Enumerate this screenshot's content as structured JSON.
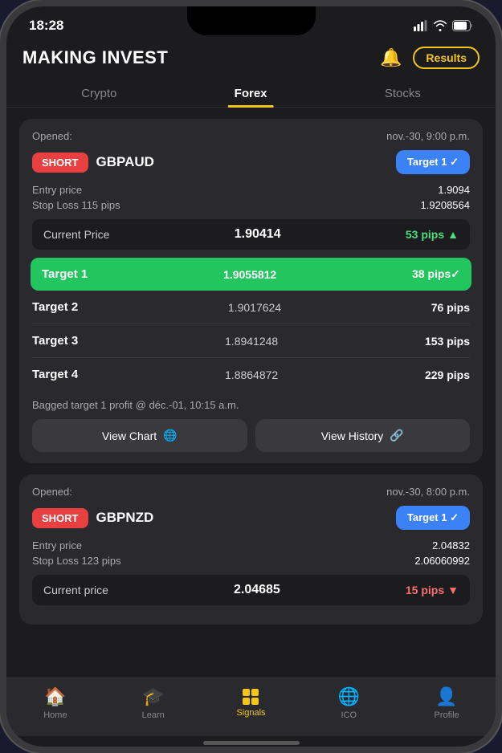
{
  "status_bar": {
    "time": "18:28"
  },
  "header": {
    "title": "MAKING INVEST",
    "results_label": "Results"
  },
  "tabs": [
    {
      "id": "crypto",
      "label": "Crypto",
      "active": false
    },
    {
      "id": "forex",
      "label": "Forex",
      "active": true
    },
    {
      "id": "stocks",
      "label": "Stocks",
      "active": false
    }
  ],
  "card1": {
    "opened_label": "Opened:",
    "opened_date": "nov.-30, 9:00 p.m.",
    "trade_type": "SHORT",
    "pair": "GBPAUD",
    "target_btn": "Target 1 ✓",
    "entry_label": "Entry price",
    "entry_value": "1.9094",
    "stop_loss_label": "Stop Loss 115 pips",
    "stop_loss_value": "1.9208564",
    "current_price_label": "Current Price",
    "current_price_value": "1.90414",
    "current_pips": "53 pips",
    "current_pips_dir": "up",
    "targets": [
      {
        "name": "Target 1",
        "price": "1.9055812",
        "pips": "38 pips✓",
        "highlight": true
      },
      {
        "name": "Target 2",
        "price": "1.9017624",
        "pips": "76 pips",
        "highlight": false
      },
      {
        "name": "Target 3",
        "price": "1.8941248",
        "pips": "153 pips",
        "highlight": false
      },
      {
        "name": "Target 4",
        "price": "1.8864872",
        "pips": "229 pips",
        "highlight": false
      }
    ],
    "profit_text": "Bagged target 1 profit @ déc.-01, 10:15 a.m.",
    "view_chart_label": "View Chart",
    "view_history_label": "View History"
  },
  "card2": {
    "opened_label": "Opened:",
    "opened_date": "nov.-30, 8:00 p.m.",
    "trade_type": "SHORT",
    "pair": "GBPNZD",
    "target_btn": "Target 1 ✓",
    "entry_label": "Entry price",
    "entry_value": "2.04832",
    "stop_loss_label": "Stop Loss 123 pips",
    "stop_loss_value": "2.06060992",
    "current_price_label": "Current price",
    "current_price_value": "2.04685",
    "current_pips": "15 pips",
    "current_pips_dir": "down"
  },
  "bottom_nav": {
    "items": [
      {
        "id": "home",
        "label": "Home",
        "active": false
      },
      {
        "id": "learn",
        "label": "Learn",
        "active": false
      },
      {
        "id": "signals",
        "label": "Signals",
        "active": true
      },
      {
        "id": "ico",
        "label": "ICO",
        "active": false
      },
      {
        "id": "profile",
        "label": "Profile",
        "active": false
      }
    ]
  }
}
